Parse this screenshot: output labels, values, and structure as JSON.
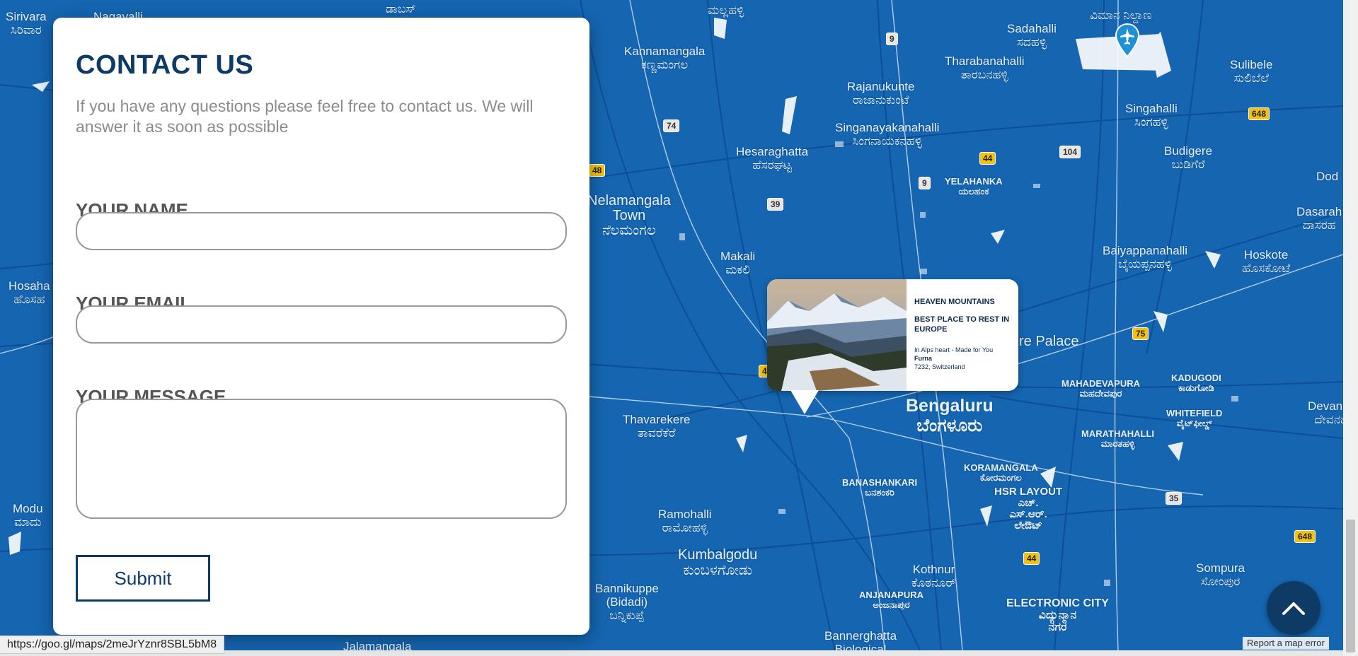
{
  "contact": {
    "title": "CONTACT US",
    "description": "If you have any questions please feel free to contact us. We will answer it as soon as possible",
    "name_label": "YOUR NAME",
    "name_value": "",
    "email_label": "YOUR EMAIL",
    "email_value": "",
    "message_label": "YOUR MESSAGE",
    "message_value": "",
    "submit_label": "Submit"
  },
  "popup": {
    "title": "HEAVEN MOUNTAINS",
    "subtitle": "BEST PLACE TO REST IN EUROPE",
    "line1": "In Alps heart - Made for You",
    "line2": "Furna",
    "line3": "7232, Switzerland"
  },
  "map": {
    "places": [
      {
        "text": "Sirivara\nಸಿರಿವಾರ"
      },
      {
        "text": "Kannamangala\nಕಣ್ಣಮಂಗಲ"
      },
      {
        "text": "Sadahalli\nಸದಹಳ್ಳಿ"
      },
      {
        "text": "Tharabanahalli\nತಾರಬನಹಳ್ಳಿ"
      },
      {
        "text": "Rajanukunte\nರಾಜಾನುಕುಂಟೆ"
      },
      {
        "text": "Sulibele\nಸುಲಿಬೆಲೆ"
      },
      {
        "text": "Singahalli\nಸಿಂಗಹಳ್ಳಿ"
      },
      {
        "text": "Singanayakanahalli\nಸಿಂಗನಾಯಕನಹಳ್ಳಿ"
      },
      {
        "text": "Hesaraghatta\nಹೆಸರಘಟ್ಟ"
      },
      {
        "text": "Budigere\nಬುಡಿಗೆರೆ"
      },
      {
        "text": "Nelamangala\nTown\nನೆಲಮಂಗಲ"
      },
      {
        "text": "Dasarah\nದಾಸರಹ"
      },
      {
        "text": "Makali\nಮಕಲಿ"
      },
      {
        "text": "Baiyappanahalli\nಬೈಯಪ್ಪನಹಳ್ಳಿ"
      },
      {
        "text": "Hoskote\nಹೊಸಕೋಟೆ"
      },
      {
        "text": "Hosaha\nಹೊಸಹ"
      },
      {
        "text": "re Palace"
      },
      {
        "text": "Thavarekere\nತಾವರೆಕೆರೆ"
      },
      {
        "text": "Devanac\nದೇವನಹ"
      },
      {
        "text": "Ramohalli\nರಾಮೋಹಳ್ಳಿ"
      },
      {
        "text": "Kumbalgodu\nಕುಂಬಳಗೋಡು"
      },
      {
        "text": "Sompura\nಸೋಂಪುರ"
      },
      {
        "text": "Bannikuppe\n(Bidadi)\nಬನ್ನಿಕುಪ್ಪೆ"
      },
      {
        "text": "Modu\nಮಾದು"
      },
      {
        "text": "Jalamangala"
      },
      {
        "text": "Bannerghatta\nBiological"
      },
      {
        "text": "Kothnur\nಕೊಠನೂರ್"
      },
      {
        "text": "ELECTRONIC CITY\nವಿದ್ಯುನ್ಮಾನ\nನಗರ"
      },
      {
        "text": "HSR LAYOUT\nಎಚ್.\nಎಸ್.ಆರ್.\nಲೇಔಟ್"
      },
      {
        "text": "Nagavalli"
      },
      {
        "text": "ಡಾಬಸ್"
      },
      {
        "text": "ಮಲ್ಲಹಳ್ಳಿ"
      },
      {
        "text": "ವಿಮಾನ ನಿಲ್ದಾಣ"
      },
      {
        "text": "Dod"
      }
    ],
    "small_places": [
      {
        "text": "YELAHANKA\nಯಲಹಂಕ"
      },
      {
        "text": "MAHADEVAPURA\nಮಹದೇವಪುರ"
      },
      {
        "text": "KADUGODI\nಕಾಡುಗೋಡಿ"
      },
      {
        "text": "WHITEFIELD\nವೈಟ್‌ಫೀಲ್ಡ್"
      },
      {
        "text": "MARATHAHALLI\nಮಾರತಹಳ್ಳಿ"
      },
      {
        "text": "BANASHANKARI\nಬನಶಂಕರಿ"
      },
      {
        "text": "KORAMANGALA\nಕೋರಮಂಗಲ"
      },
      {
        "text": "ANJANAPURA\nಅಂಜನಾಪುರ"
      }
    ],
    "city": "Bengaluru\nಬೆಂಗಳೂರು",
    "shields": [
      "9",
      "74",
      "48",
      "39",
      "9",
      "44",
      "104",
      "648",
      "75",
      "35",
      "44",
      "648",
      "4"
    ],
    "report_label": "Report a map error"
  },
  "status_url": "https://goo.gl/maps/2meJrYznr8SBL5bM8",
  "icons": {
    "airport": "airplane-pin-icon",
    "to_top": "chevron-up-icon"
  },
  "colors": {
    "map_blue": "#1565b0",
    "brand_navy": "#0d3b66",
    "road": "#0e4a8c"
  }
}
